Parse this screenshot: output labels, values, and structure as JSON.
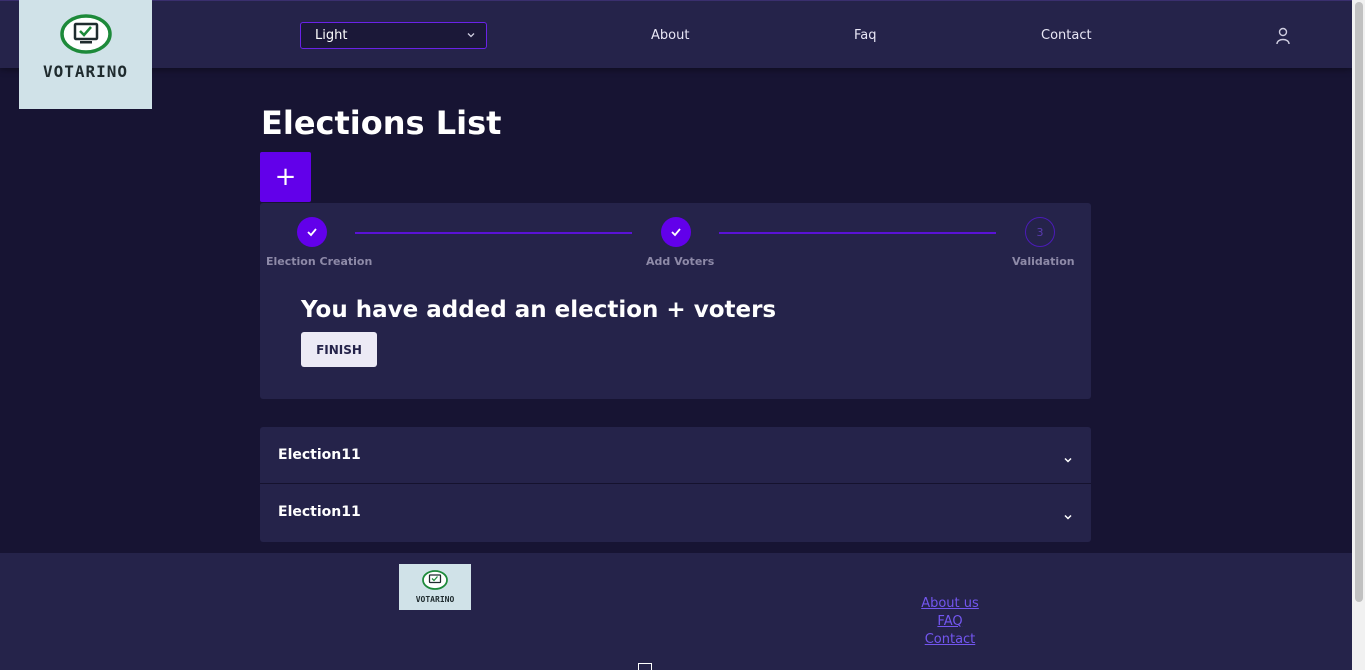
{
  "header": {
    "logo_text": "VOTARINO",
    "theme_select": {
      "value": "Light"
    },
    "nav": [
      "About",
      "Faq",
      "Contact"
    ]
  },
  "main": {
    "title": "Elections List",
    "add_button": "+",
    "stepper": {
      "steps": [
        {
          "label": "Election Creation",
          "state": "done"
        },
        {
          "label": "Add Voters",
          "state": "done"
        },
        {
          "label": "Validation",
          "state": "pending",
          "number": "3"
        }
      ],
      "message": "You have added an election + voters",
      "finish_label": "FINISH"
    },
    "elections": [
      "Election11",
      "Election11"
    ]
  },
  "footer": {
    "logo_text": "VOTARINO",
    "links": [
      "About us",
      "FAQ",
      "Contact"
    ]
  },
  "colors": {
    "background": "#171433",
    "surface": "#25234a",
    "accent": "#6200ea",
    "link": "#7356f0"
  }
}
